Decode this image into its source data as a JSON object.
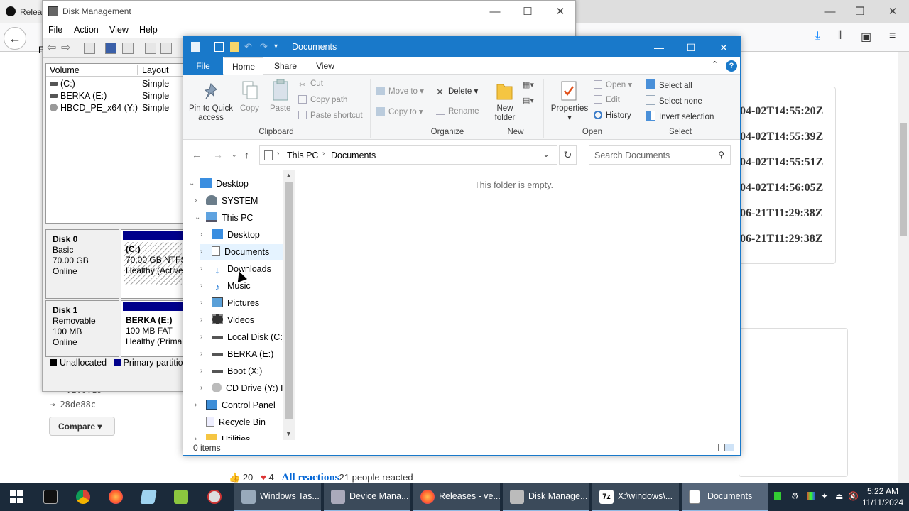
{
  "browser": {
    "tab_title": "Relea",
    "timestamps": [
      "04-02T14:55:20Z",
      "04-02T14:55:39Z",
      "04-02T14:55:51Z",
      "04-02T14:56:05Z",
      "06-21T11:29:38Z",
      "06-21T11:29:38Z"
    ],
    "version_fragment": "v1.0.19",
    "commit": "28de88c",
    "compare_label": "Compare",
    "reactions": {
      "thumbs": "20",
      "hearts": "4",
      "link": "All reactions",
      "text": "21 people reacted"
    }
  },
  "disk_mgmt": {
    "title": "Disk Management",
    "menu": [
      "File",
      "Action",
      "View",
      "Help"
    ],
    "columns": [
      "Volume",
      "Layout"
    ],
    "volumes": [
      {
        "name": "(C:)",
        "layout": "Simple"
      },
      {
        "name": "BERKA (E:)",
        "layout": "Simple"
      },
      {
        "name": "HBCD_PE_x64 (Y:)",
        "layout": "Simple"
      }
    ],
    "disks": [
      {
        "name": "Disk 0",
        "type": "Basic",
        "size": "70.00 GB",
        "status": "Online",
        "part_name": "(C:)",
        "part_size": "70.00 GB NTFS",
        "part_status": "Healthy (Active"
      },
      {
        "name": "Disk 1",
        "type": "Removable",
        "size": "100 MB",
        "status": "Online",
        "part_name": "BERKA  (E:)",
        "part_size": "100 MB FAT",
        "part_status": "Healthy (Prima"
      }
    ],
    "legend": [
      "Unallocated",
      "Primary partition"
    ],
    "stub_left": [
      "F",
      "N",
      "0."
    ]
  },
  "explorer": {
    "title": "Documents",
    "tabs": {
      "file": "File",
      "home": "Home",
      "share": "Share",
      "view": "View"
    },
    "ribbon": {
      "pin": [
        "Pin to Quick",
        "access"
      ],
      "copy": "Copy",
      "paste": "Paste",
      "cut": "Cut",
      "copy_path": "Copy path",
      "paste_shortcut": "Paste shortcut",
      "clipboard": "Clipboard",
      "move_to": "Move to",
      "copy_to": "Copy to",
      "delete": "Delete",
      "rename": "Rename",
      "organize": "Organize",
      "new_folder": [
        "New",
        "folder"
      ],
      "new": "New",
      "properties": "Properties",
      "open_btn": "Open",
      "edit": "Edit",
      "history": "History",
      "open_group": "Open",
      "select_all": "Select all",
      "select_none": "Select none",
      "invert_selection": "Invert selection",
      "select_group": "Select"
    },
    "address": {
      "crumbs": [
        "This PC",
        "Documents"
      ]
    },
    "search_placeholder": "Search Documents",
    "nav": [
      {
        "label": "Desktop"
      },
      {
        "label": "SYSTEM"
      },
      {
        "label": "This PC"
      },
      {
        "label": "Desktop"
      },
      {
        "label": "Documents"
      },
      {
        "label": "Downloads"
      },
      {
        "label": "Music"
      },
      {
        "label": "Pictures"
      },
      {
        "label": "Videos"
      },
      {
        "label": "Local Disk (C:)"
      },
      {
        "label": "BERKA (E:)"
      },
      {
        "label": "Boot (X:)"
      },
      {
        "label": "CD Drive (Y:) H"
      },
      {
        "label": "Control Panel"
      },
      {
        "label": "Recycle Bin"
      },
      {
        "label": "Utilities"
      }
    ],
    "empty_text": "This folder is empty.",
    "status": "0 items"
  },
  "taskbar": {
    "buttons": [
      "Windows Tas...",
      "Device Mana...",
      "Releases - ve...",
      "Disk Manage...",
      "X:\\windows\\...",
      "Documents"
    ],
    "time": "5:22 AM",
    "date": "11/11/2024"
  },
  "colors": {
    "accent": "#1979ca",
    "taskbar": "#1b2a3a",
    "disk_bar": "#00008b"
  }
}
